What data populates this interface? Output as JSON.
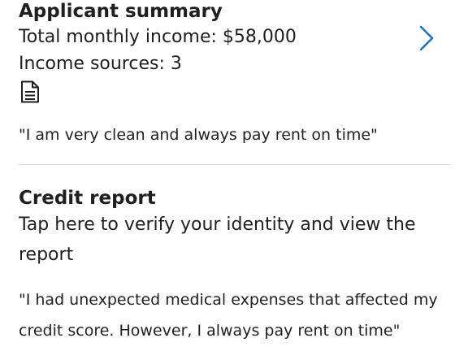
{
  "applicant_summary": {
    "title": "Applicant summary",
    "total_income": "Total monthly income: $58,000",
    "income_sources": "Income sources: 3",
    "document_icon": "document-icon",
    "chevron_icon": "chevron-right-icon",
    "quote": "\"I am very clean and always pay rent on time\""
  },
  "credit_report": {
    "title": "Credit report",
    "prompt": "Tap here to verify your identity and view the report",
    "quote": "\"I had unexpected medical expenses that affected my credit score. However, I always pay rent on time\""
  },
  "colors": {
    "accent": "#1a73c9",
    "text": "#1f1f1f",
    "divider": "#d8d8d8"
  }
}
